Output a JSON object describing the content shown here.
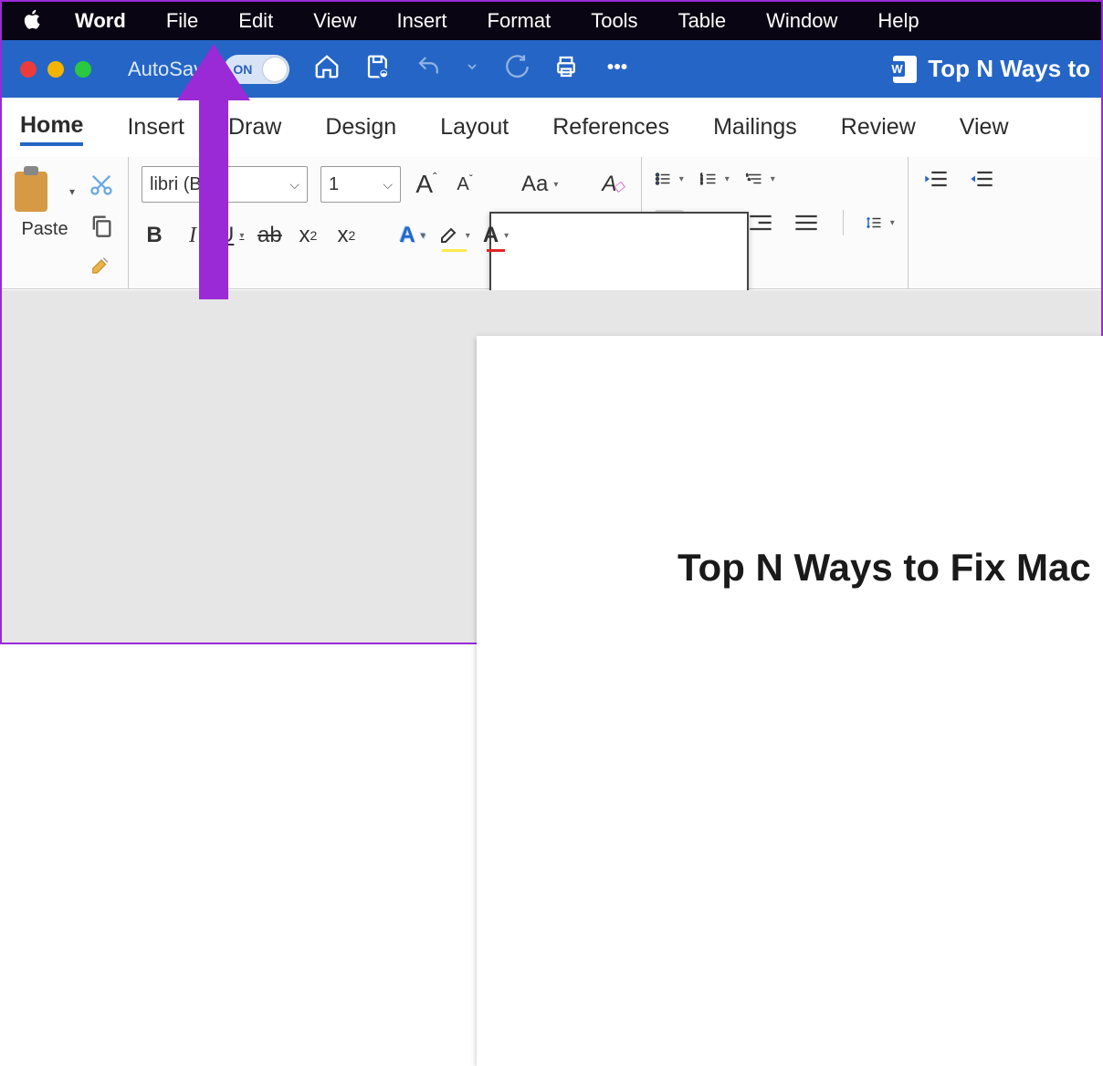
{
  "mac_menu": {
    "app": "Word",
    "items": [
      "File",
      "Edit",
      "View",
      "Insert",
      "Format",
      "Tools",
      "Table",
      "Window",
      "Help"
    ]
  },
  "title_bar": {
    "autosave_label": "AutoSave",
    "autosave_toggle": "ON",
    "document_title": "Top N Ways to"
  },
  "ribbon_tabs": [
    "Home",
    "Insert",
    "Draw",
    "Design",
    "Layout",
    "References",
    "Mailings",
    "Review",
    "View"
  ],
  "active_tab": "Home",
  "clipboard": {
    "paste_label": "Paste"
  },
  "font": {
    "family": "libri (Bo…",
    "family_full": "Calibri (Body)",
    "size": "1",
    "grow": "A",
    "shrink": "A",
    "changecase": "Aa",
    "bold": "B",
    "italic": "I",
    "underline": "U",
    "strike": "ab",
    "sub": "x",
    "sub_n": "2",
    "sup": "x",
    "sup_n": "2",
    "text_effects": "A",
    "highlight": "A",
    "font_color": "A"
  },
  "document": {
    "heading": "Top N Ways to Fix Mac "
  }
}
